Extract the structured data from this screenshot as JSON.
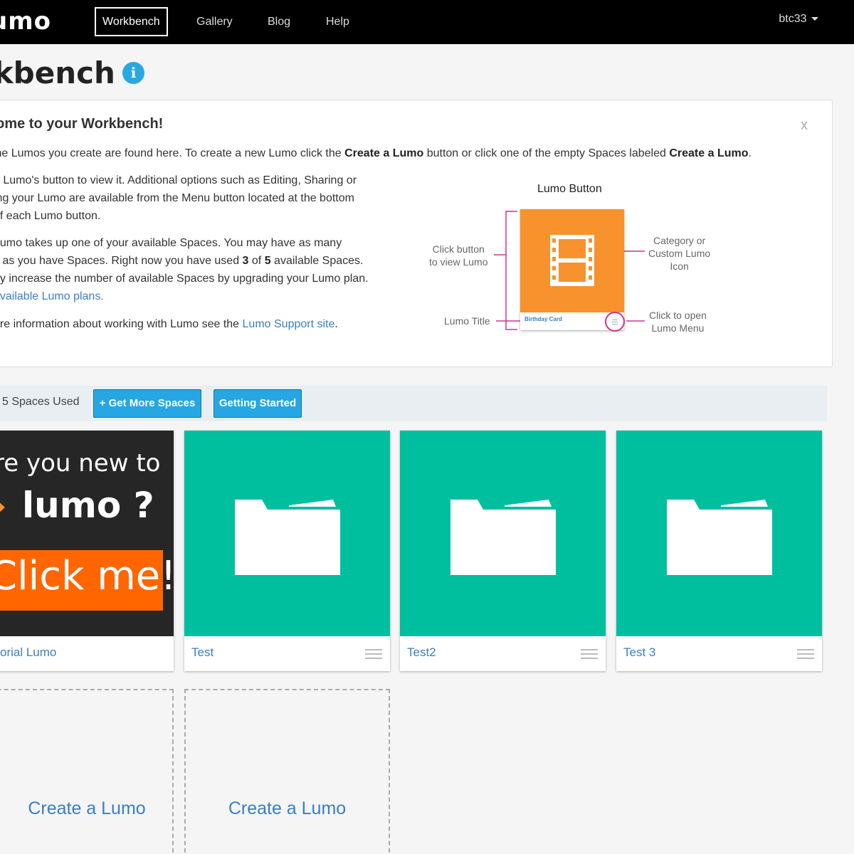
{
  "navbar": {
    "brand": "umo",
    "items": [
      {
        "label": "Workbench",
        "active": true
      },
      {
        "label": "Gallery"
      },
      {
        "label": "Blog"
      },
      {
        "label": "Help"
      }
    ],
    "user": "btc33"
  },
  "page": {
    "title": "rkbench",
    "info_icon": "i"
  },
  "welcome": {
    "title": "come to your Workbench!",
    "close": "x",
    "p1_a": " the Lumos you create are found here. To create a new Lumo click the ",
    "p1_b1": "Create a Lumo",
    "p1_c": " button or click one of the empty Spaces labeled ",
    "p1_b2": "Create a Lumo",
    "p1_d": ".",
    "p2_l1": "a Lumo's button to view it. Additional options such as Editing, Sharing or",
    "p2_l2": "ing your Lumo are available from the Menu button located at the bottom",
    "p2_l3": "of each Lumo button.",
    "p3_l1": "Lumo takes up one of your available Spaces. You may have as many",
    "p3_l2a": "s as you have Spaces. Right now you have used ",
    "p3_used": "3",
    "p3_of": " of ",
    "p3_total": "5",
    "p3_l2b": " available Spaces.",
    "p3_l3": "ay increase the number of available Spaces by upgrading your Lumo plan.",
    "p3_link": "available Lumo plans.",
    "p4_a": "ore information about working with Lumo see the ",
    "p4_link": "Lumo Support site",
    "p4_b": ".",
    "diagram": {
      "title": "Lumo Button",
      "click_button_l1": "Click button",
      "click_button_l2": "to view Lumo",
      "category_l1": "Category or",
      "category_l2": "Custom Lumo",
      "category_l3": "Icon",
      "lumo_title": "Lumo Title",
      "click_open_l1": "Click to open",
      "click_open_l2": "Lumo Menu",
      "demo_card_title": "Birthday Card",
      "icon": "film-icon",
      "card_color": "#f7922d",
      "marker_color": "#d0338b"
    }
  },
  "spaces": {
    "used_text": "5  Spaces Used",
    "get_more_label": "+ Get More Spaces",
    "getting_started_label": "Getting Started"
  },
  "tutorial": {
    "line1": "re you new to",
    "lumo": "lumo ?",
    "click": "Click me!",
    "label": "orial Lumo"
  },
  "cards": [
    {
      "label": "Test",
      "icon": "folder-icon"
    },
    {
      "label": "Test2",
      "icon": "folder-icon"
    },
    {
      "label": "Test 3",
      "icon": "folder-icon"
    }
  ],
  "empty_spaces": [
    {
      "label": "Create a Lumo"
    },
    {
      "label": "Create a Lumo"
    }
  ],
  "colors": {
    "accent": "#26a7e3",
    "teal": "#00bf9f",
    "orange": "#ff6600",
    "link": "#3b7ec2"
  }
}
